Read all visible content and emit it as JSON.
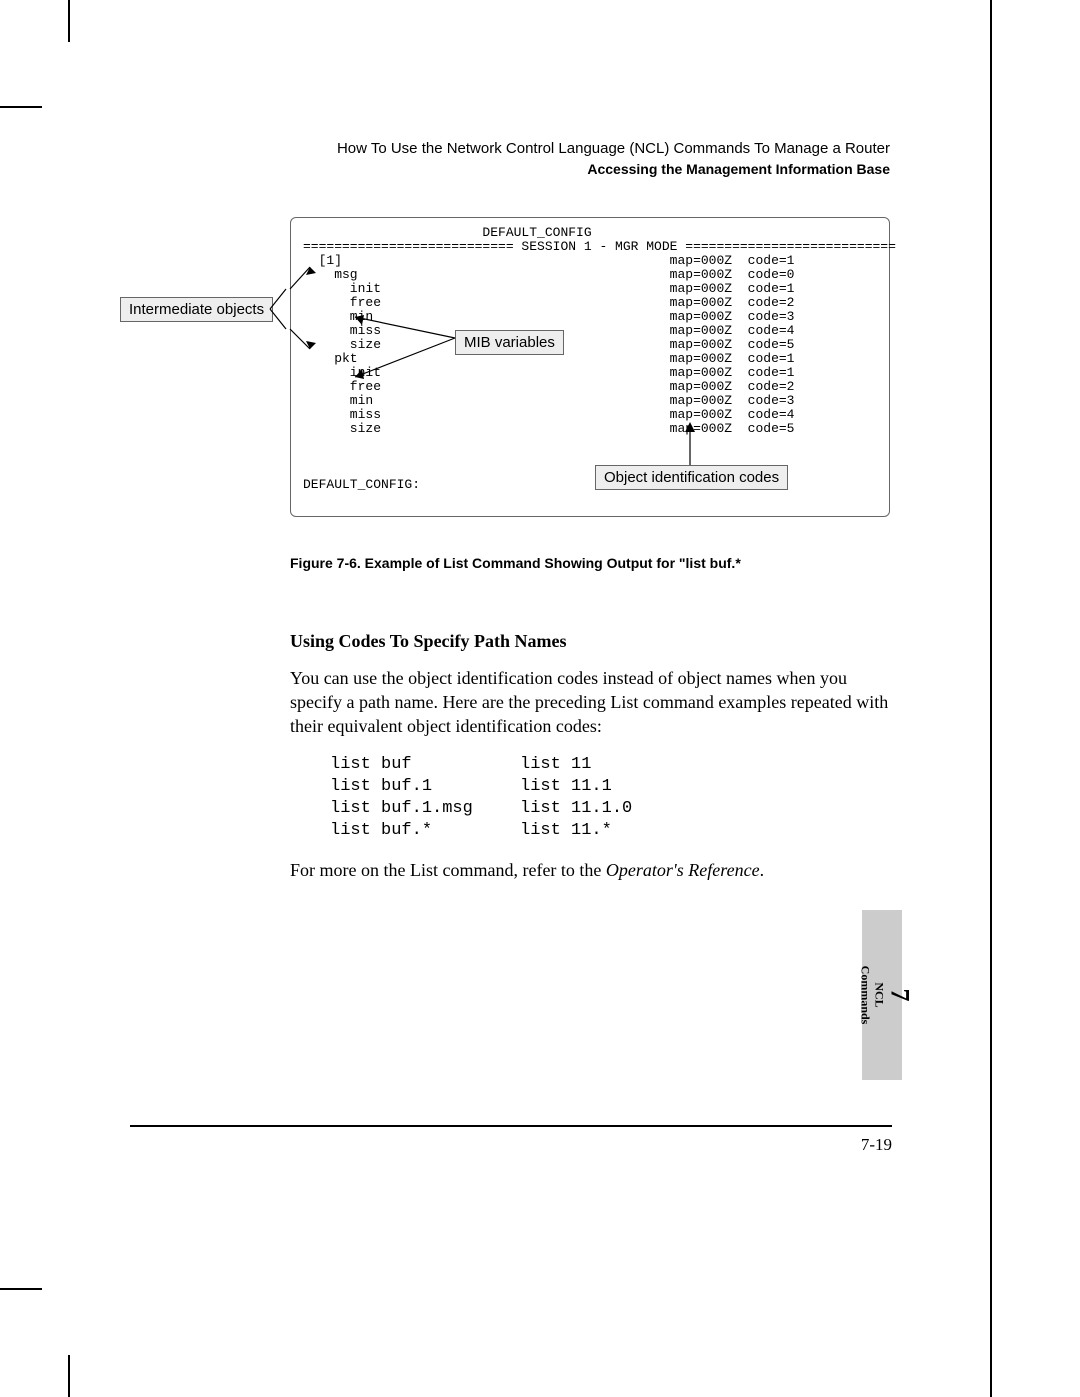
{
  "header": {
    "running": "How To Use the Network Control Language (NCL) Commands To Manage a Router",
    "sub": "Accessing the Management Information Base"
  },
  "figure": {
    "labels": {
      "intermediate": "Intermediate objects",
      "mib": "MIB variables",
      "oid": "Object identification codes"
    },
    "console_top": "                       DEFAULT_CONFIG",
    "console_sep": "=========================== SESSION 1 - MGR MODE ===========================",
    "console_tree": "  [1]                                          map=000Z  code=1\n    msg                                        map=000Z  code=0\n      init                                     map=000Z  code=1\n      free                                     map=000Z  code=2\n      min                                      map=000Z  code=3\n      miss                                     map=000Z  code=4\n      size                                     map=000Z  code=5\n    pkt                                        map=000Z  code=1\n      init                                     map=000Z  code=1\n      free                                     map=000Z  code=2\n      min                                      map=000Z  code=3\n      miss                                     map=000Z  code=4\n      size                                     map=000Z  code=5",
    "console_prompt": "DEFAULT_CONFIG:",
    "caption": "Figure  7-6. Example of List Command Showing Output for \"list buf.*"
  },
  "section": {
    "heading": "Using Codes To Specify Path Names",
    "para1": "You can use the object identification codes instead of object names when you specify a path name. Here are the preceding List command examples repeated with their equivalent object identification codes:",
    "code": [
      {
        "a": "list buf",
        "b": "list 11"
      },
      {
        "a": "list buf.1",
        "b": "list 11.1"
      },
      {
        "a": "list buf.1.msg",
        "b": "list 11.1.0"
      },
      {
        "a": "list buf.*",
        "b": "list 11.*"
      }
    ],
    "para2_pre": "For more on the List command, refer to the ",
    "para2_em": "Operator's Reference",
    "para2_post": "."
  },
  "tab": {
    "num": "7",
    "line1": "NCL",
    "line2": "Commands"
  },
  "footer": {
    "pagenum": "7-19"
  }
}
